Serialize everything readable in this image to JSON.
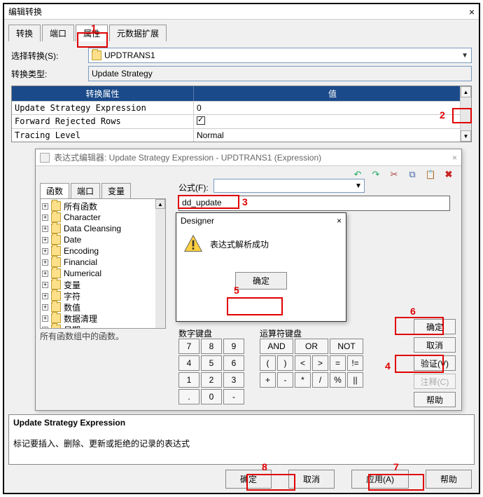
{
  "main": {
    "title": "编辑转换",
    "tabs": [
      "转换",
      "端口",
      "属性",
      "元数据扩展"
    ],
    "select_label": "选择转换(S):",
    "select_value": "UPDTRANS1",
    "type_label": "转换类型:",
    "type_value": "Update Strategy",
    "col_attr": "转换属性",
    "col_val": "值",
    "rows": [
      {
        "name": "Update Strategy Expression",
        "value": "0"
      },
      {
        "name": "Forward Rejected Rows",
        "value": "checked"
      },
      {
        "name": "Tracing Level",
        "value": "Normal"
      }
    ]
  },
  "expr": {
    "title": "表达式编辑器: Update Strategy Expression - UPDTRANS1 (Expression)",
    "inner_tabs": [
      "函数",
      "端口",
      "变量"
    ],
    "tree": [
      "所有函数",
      "Character",
      "Data Cleansing",
      "Date",
      "Encoding",
      "Financial",
      "Numerical",
      "变量",
      "字符",
      "数值",
      "数据清理",
      "日期"
    ],
    "tree_desc": "所有函数组中的函数。",
    "formula_label": "公式(F):",
    "formula_value": "dd_update",
    "numpad_label": "数字键盘",
    "oppad_label": "运算符键盘",
    "numpad": [
      [
        "7",
        "8",
        "9"
      ],
      [
        "4",
        "5",
        "6"
      ],
      [
        "1",
        "2",
        "3"
      ],
      [
        ".",
        "0",
        "-"
      ]
    ],
    "oppad": [
      [
        "AND",
        "OR",
        "NOT"
      ],
      [
        "(",
        ")",
        "<",
        ">",
        "=",
        "!="
      ],
      [
        "+",
        "-",
        "*",
        "/",
        "%",
        "||"
      ]
    ],
    "side": {
      "ok": "确定",
      "cancel": "取消",
      "validate": "验证(V)",
      "comment": "注释(C)",
      "help": "帮助"
    }
  },
  "designer": {
    "title": "Designer",
    "msg": "表达式解析成功",
    "ok": "确定"
  },
  "desc": {
    "title": "Update Strategy Expression",
    "text": "标记要插入、删除、更新或拒绝的记录的表达式"
  },
  "bottom": {
    "ok": "确定",
    "cancel": "取消",
    "apply": "应用(A)",
    "help": "帮助"
  },
  "annot": {
    "n1": "1",
    "n2": "2",
    "n3": "3",
    "n4": "4",
    "n5": "5",
    "n6": "6",
    "n7": "7",
    "n8": "8"
  }
}
